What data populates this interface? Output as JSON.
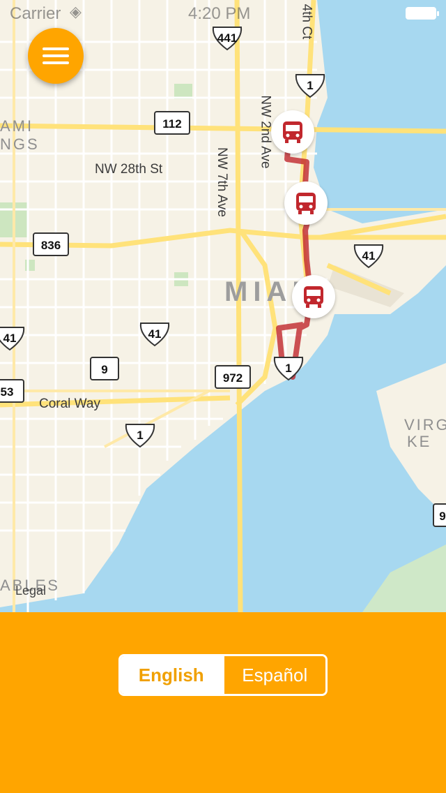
{
  "status_bar": {
    "carrier": "Carrier",
    "time": "4:20 PM"
  },
  "map": {
    "city_label": "MIAMI",
    "area_labels": [
      "AMI",
      "NGS",
      "VIRG",
      "KE",
      "ABLES"
    ],
    "street_labels": [
      "NW 28th St",
      "NW 7th Ave",
      "NW 2nd Ave",
      "Coral Way",
      "4th Ct"
    ],
    "route_shields": [
      "441",
      "1",
      "112",
      "836",
      "41",
      "41",
      "9",
      "972",
      "41",
      "53",
      "1",
      "1",
      "9"
    ],
    "legal": "Legal",
    "route_color": "#c1272d",
    "water_color": "#a7d8f0"
  },
  "bus_stops": [
    "bus-stop",
    "bus-stop",
    "bus-stop"
  ],
  "language_toggle": {
    "options": [
      "English",
      "Español"
    ],
    "selected": "English"
  },
  "colors": {
    "accent": "#ffa500"
  }
}
